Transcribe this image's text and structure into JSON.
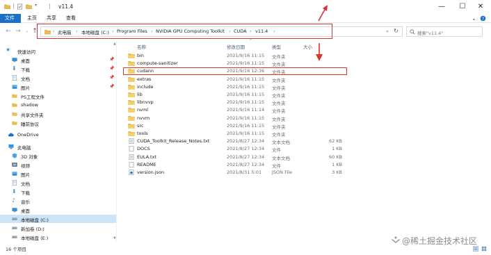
{
  "window": {
    "title": "v11.4",
    "controls": {
      "minimize": "—",
      "maximize": "☐",
      "close": "✕"
    }
  },
  "ribbon": {
    "tabs": [
      "文件",
      "主页",
      "共享",
      "查看"
    ],
    "active_tab": "文件",
    "accent_color": "#1a6fc7"
  },
  "address": {
    "breadcrumbs": [
      "此电脑",
      "本地磁盘 (C:)",
      "Program Files",
      "NVIDIA GPU Computing Toolkit",
      "CUDA",
      "v11.4"
    ],
    "separator": "›",
    "search_placeholder": "搜索\"v11.4\""
  },
  "columns": {
    "name": "名称",
    "date": "修改日期",
    "type": "类型",
    "size": "大小"
  },
  "files": [
    {
      "name": "bin",
      "date": "2021/9/16 11:15",
      "type": "文件夹",
      "size": "",
      "icon": "folder-icon"
    },
    {
      "name": "compute-sanitizer",
      "date": "2021/9/16 11:15",
      "type": "文件夹",
      "size": "",
      "icon": "folder-icon"
    },
    {
      "name": "cudann",
      "date": "2021/9/16 12:36",
      "type": "文件夹",
      "size": "",
      "icon": "folder-icon"
    },
    {
      "name": "extras",
      "date": "2021/9/16 11:15",
      "type": "文件夹",
      "size": "",
      "icon": "folder-icon"
    },
    {
      "name": "include",
      "date": "2021/9/16 11:15",
      "type": "文件夹",
      "size": "",
      "icon": "folder-icon"
    },
    {
      "name": "lib",
      "date": "2021/9/16 11:15",
      "type": "文件夹",
      "size": "",
      "icon": "folder-icon"
    },
    {
      "name": "libnvvp",
      "date": "2021/9/16 11:15",
      "type": "文件夹",
      "size": "",
      "icon": "folder-icon"
    },
    {
      "name": "nvml",
      "date": "2021/9/16 11:14",
      "type": "文件夹",
      "size": "",
      "icon": "folder-icon"
    },
    {
      "name": "nvvm",
      "date": "2021/9/16 11:15",
      "type": "文件夹",
      "size": "",
      "icon": "folder-icon"
    },
    {
      "name": "src",
      "date": "2021/9/16 11:15",
      "type": "文件夹",
      "size": "",
      "icon": "folder-icon"
    },
    {
      "name": "tools",
      "date": "2021/9/16 11:15",
      "type": "文件夹",
      "size": "",
      "icon": "folder-icon"
    },
    {
      "name": "CUDA_Toolkit_Release_Notes.txt",
      "date": "2021/8/27 12:34",
      "type": "文本文档",
      "size": "62 KB",
      "icon": "text-file-icon"
    },
    {
      "name": "DOCS",
      "date": "2021/8/27 12:34",
      "type": "文件",
      "size": "1 KB",
      "icon": "file-icon"
    },
    {
      "name": "EULA.txt",
      "date": "2021/8/27 12:34",
      "type": "文本文档",
      "size": "60 KB",
      "icon": "text-file-icon"
    },
    {
      "name": "README",
      "date": "2021/8/27 12:34",
      "type": "文件",
      "size": "1 KB",
      "icon": "file-icon"
    },
    {
      "name": "version.json",
      "date": "2021/8/31 5:01",
      "type": "JSON File",
      "size": "3 KB",
      "icon": "json-file-icon"
    }
  ],
  "nav": [
    {
      "label": "快速访问",
      "icon": "star-icon",
      "pinned": false
    },
    {
      "label": "桌面",
      "icon": "desktop-icon",
      "pinned": true
    },
    {
      "label": "下载",
      "icon": "download-icon",
      "pinned": true
    },
    {
      "label": "文档",
      "icon": "document-icon",
      "pinned": true
    },
    {
      "label": "图片",
      "icon": "picture-icon",
      "pinned": true
    },
    {
      "label": "PS工程文件",
      "icon": "folder-icon",
      "pinned": false
    },
    {
      "label": "shadow",
      "icon": "folder-icon",
      "pinned": false
    },
    {
      "label": "共享文件夹",
      "icon": "folder-icon",
      "pinned": false
    },
    {
      "label": "睡前协议",
      "icon": "folder-icon",
      "pinned": false
    },
    {
      "label": "OneDrive",
      "icon": "cloud-icon",
      "pinned": false
    },
    {
      "label": "此电脑",
      "icon": "computer-icon",
      "pinned": false
    },
    {
      "label": "3D 对象",
      "icon": "cube-icon",
      "pinned": false
    },
    {
      "label": "视频",
      "icon": "video-icon",
      "pinned": false
    },
    {
      "label": "图片",
      "icon": "picture-icon",
      "pinned": false
    },
    {
      "label": "文档",
      "icon": "document-icon",
      "pinned": false
    },
    {
      "label": "下载",
      "icon": "download-icon",
      "pinned": false
    },
    {
      "label": "音乐",
      "icon": "music-icon",
      "pinned": false
    },
    {
      "label": "桌面",
      "icon": "desktop-icon",
      "pinned": false
    },
    {
      "label": "本地磁盘 (C:)",
      "icon": "drive-icon",
      "pinned": false,
      "selected": true
    },
    {
      "label": "新加卷 (D:)",
      "icon": "drive-icon",
      "pinned": false
    },
    {
      "label": "本地磁盘 (E:)",
      "icon": "drive-icon",
      "pinned": false
    }
  ],
  "status": {
    "item_count": "16 个项目"
  },
  "watermark": "@稀土掘金技术社区",
  "annotation_color": "#d9322f",
  "folder_color": "#e8bc4e"
}
